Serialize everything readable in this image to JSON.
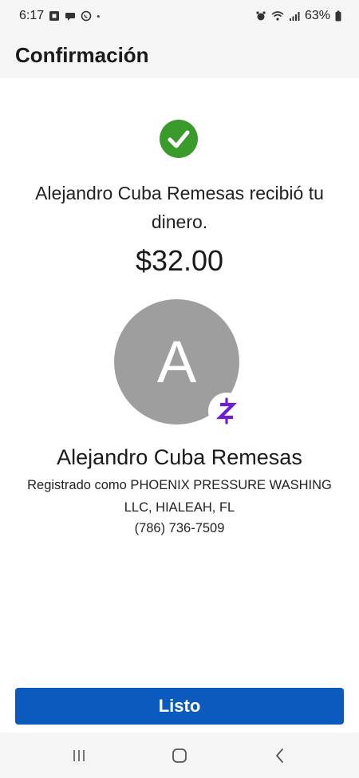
{
  "status_bar": {
    "time": "6:17",
    "battery": "63%",
    "icons": [
      "chase-icon",
      "chat-icon",
      "whatsapp-icon",
      "dot-icon",
      "alarm-icon",
      "wifi-icon",
      "signal-icon",
      "battery-icon"
    ]
  },
  "header": {
    "title": "Confirmación"
  },
  "confirmation": {
    "icon": "check-circle-icon",
    "accent_color": "#3a9a2c",
    "message": "Alejandro Cuba Remesas recibió tu dinero.",
    "amount": "$32.00"
  },
  "recipient": {
    "avatar_letter": "A",
    "badge_icon": "zelle-icon",
    "badge_color": "#6d1ed4",
    "name": "Alejandro Cuba Remesas",
    "registered_as": "Registrado como PHOENIX PRESSURE WASHING LLC, HIALEAH, FL",
    "phone": "(786) 736-7509"
  },
  "actions": {
    "done_label": "Listo",
    "button_color": "#0b5bbf"
  },
  "nav_bar": {
    "buttons": [
      "recents-icon",
      "home-icon",
      "back-icon"
    ]
  }
}
